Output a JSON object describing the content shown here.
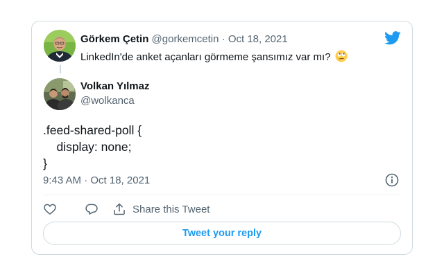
{
  "parent_tweet": {
    "author_name": "Görkem Çetin",
    "handle": "@gorkemcetin",
    "separator": "·",
    "date": "Oct 18, 2021",
    "text": "LinkedIn'de anket açanları görmeme şansımız var mı?",
    "emoji": "face-with-rolling-eyes-emoji"
  },
  "tweet": {
    "author_name": "Volkan Yılmaz",
    "handle": "@wolkanca",
    "code_lines": [
      ".feed-shared-poll {",
      "    display: none;",
      "}"
    ],
    "timestamp": "9:43 AM · Oct 18, 2021"
  },
  "actions": {
    "like_icon": "heart-icon",
    "reply_icon": "comment-icon",
    "share_icon": "share-icon",
    "share_label": "Share this Tweet"
  },
  "reply_button_label": "Tweet your reply",
  "colors": {
    "accent": "#1d9bf0",
    "text": "#0f1419",
    "muted": "#536471",
    "border": "#cfd9de"
  }
}
